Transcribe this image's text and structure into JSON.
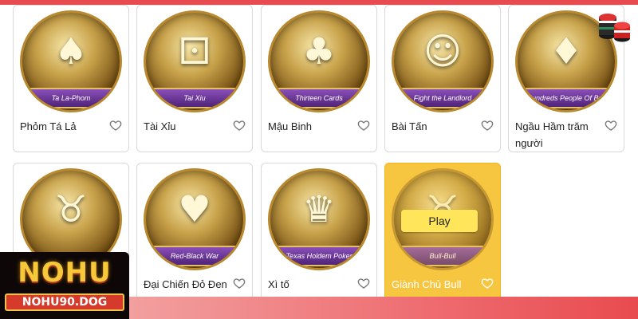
{
  "colors": {
    "accent": "#e84b4f",
    "highlight": "#f6c640",
    "play_button": "#ffe55a"
  },
  "games": [
    {
      "title": "Phỏm Tá Lả",
      "banner": "Ta La-Phom",
      "icon": "phom-cards-icon",
      "glyph": "♠"
    },
    {
      "title": "Tài Xỉu",
      "banner": "Tai Xiu",
      "icon": "dice-cup-icon",
      "glyph": "⚀"
    },
    {
      "title": "Mậu Binh",
      "banner": "Thirteen Cards",
      "icon": "revolver-cards-icon",
      "glyph": "♣"
    },
    {
      "title": "Bài Tấn",
      "banner": "Fight the Landlord",
      "icon": "landlord-character-icon",
      "glyph": "☺"
    },
    {
      "title": "Ngầu Hầm trăm người",
      "banner": "Hundreds People Of Bull",
      "icon": "cowboy-hat-icon",
      "glyph": "♦"
    },
    {
      "title": "",
      "banner": "",
      "icon": "bull-character-icon",
      "glyph": "♉"
    },
    {
      "title": "Đại Chiến Đỏ Đen",
      "banner": "Red-Black War",
      "icon": "versus-cards-icon",
      "glyph": "♥"
    },
    {
      "title": "Xì tố",
      "banner": "Texas Holdem Poker",
      "icon": "crown-cards-icon",
      "glyph": "♛"
    },
    {
      "title": "Giành Chủ Bull",
      "banner": "Bull-Bull",
      "icon": "bull-bull-icon",
      "glyph": "♉",
      "play_label": "Play"
    }
  ],
  "logo": {
    "main": "NOHU",
    "sub": "NOHU90.DOG"
  },
  "icons": {
    "favorite": "heart-outline-icon",
    "chips": "casino-chips-icon"
  }
}
